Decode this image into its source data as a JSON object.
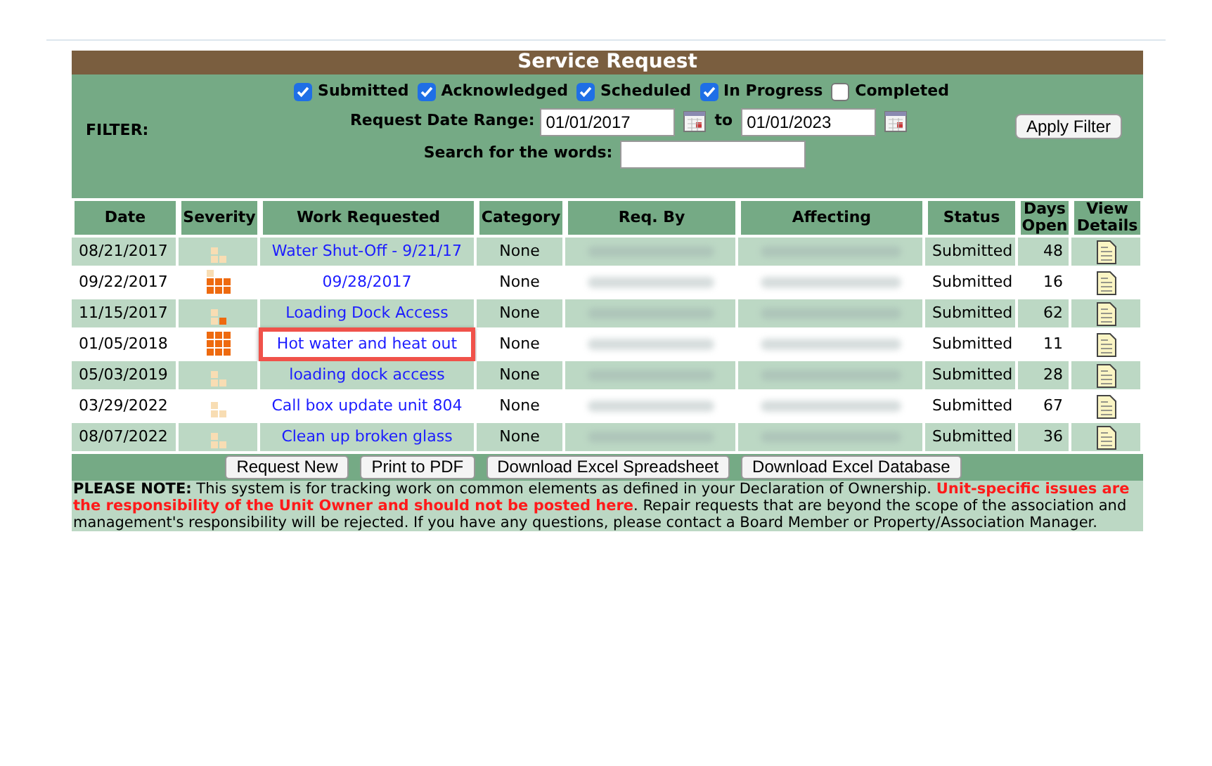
{
  "title": "Service Request",
  "filter": {
    "label": "FILTER:",
    "statuses": [
      {
        "label": "Submitted",
        "checked": true
      },
      {
        "label": "Acknowledged",
        "checked": true
      },
      {
        "label": "Scheduled",
        "checked": true
      },
      {
        "label": "In Progress",
        "checked": true
      },
      {
        "label": "Completed",
        "checked": false
      }
    ],
    "date_label": "Request Date Range:",
    "date_from": "01/01/2017",
    "date_to_label": "to",
    "date_to": "01/01/2023",
    "search_label": "Search for the words:",
    "apply_button": "Apply Filter"
  },
  "table": {
    "columns": [
      "Date",
      "Severity",
      "Work Requested",
      "Category",
      "Req. By",
      "Affecting",
      "Status",
      "Days Open",
      "View Details"
    ],
    "rows": [
      {
        "date": "08/21/2017",
        "kind": "low",
        "work": "Water Shut-Off - 9/21/17",
        "category": "None",
        "status": "Submitted",
        "days_open": "48",
        "highlighted": false
      },
      {
        "date": "09/22/2017",
        "kind": "high",
        "work": "09/28/2017",
        "category": "None",
        "status": "Submitted",
        "days_open": "16",
        "highlighted": false
      },
      {
        "date": "11/15/2017",
        "kind": "medium",
        "work": "Loading Dock Access",
        "category": "None",
        "status": "Submitted",
        "days_open": "62",
        "highlighted": false
      },
      {
        "date": "01/05/2018",
        "kind": "urgent",
        "work": "Hot water and heat out",
        "category": "None",
        "status": "Submitted",
        "days_open": "11",
        "highlighted": true
      },
      {
        "date": "05/03/2019",
        "kind": "low",
        "work": "loading dock access",
        "category": "None",
        "status": "Submitted",
        "days_open": "28",
        "highlighted": false
      },
      {
        "date": "03/29/2022",
        "kind": "low",
        "work": "Call box update unit 804",
        "category": "None",
        "status": "Submitted",
        "days_open": "67",
        "highlighted": false
      },
      {
        "date": "08/07/2022",
        "kind": "low",
        "work": "Clean up broken glass",
        "category": "None",
        "status": "Submitted",
        "days_open": "36",
        "highlighted": false
      }
    ]
  },
  "buttons": [
    "Request New",
    "Print to PDF",
    "Download Excel Spreadsheet",
    "Download Excel Database"
  ],
  "note": "**PLEASE NOTE:** This system is for tracking work on common elements as defined in your Declaration of Ownership.",
  "note_warning": "Unit-specific issues are the responsibility of the Unit Owner and should not be posted here",
  "note_rest": ". Repair requests that are beyond the scope of the association and management's responsibility will be rejected. If you have any questions, please contact a Board Member or Property/Association Manager."
}
